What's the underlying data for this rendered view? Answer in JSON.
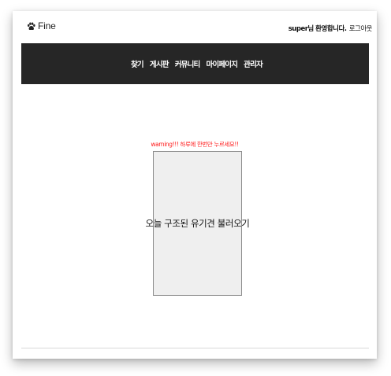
{
  "header": {
    "logo_text": "Fine",
    "logo_icon": "paw-icon",
    "user_name": "super",
    "user_greeting": "님 환영합니다.",
    "logout_label": "로그아웃"
  },
  "nav": {
    "items": [
      {
        "label": "찾기"
      },
      {
        "label": "게시판"
      },
      {
        "label": "커뮤니티"
      },
      {
        "label": "마이페이지"
      },
      {
        "label": "관리자"
      }
    ]
  },
  "main": {
    "warning_text": "warning!!! 하루에 한번만 누르세요!!",
    "button_label": "오늘 구조된 유기견 불러오기"
  },
  "colors": {
    "navbar_bg": "#262626",
    "warning": "#ff1a1a",
    "button_bg": "#efefef"
  }
}
